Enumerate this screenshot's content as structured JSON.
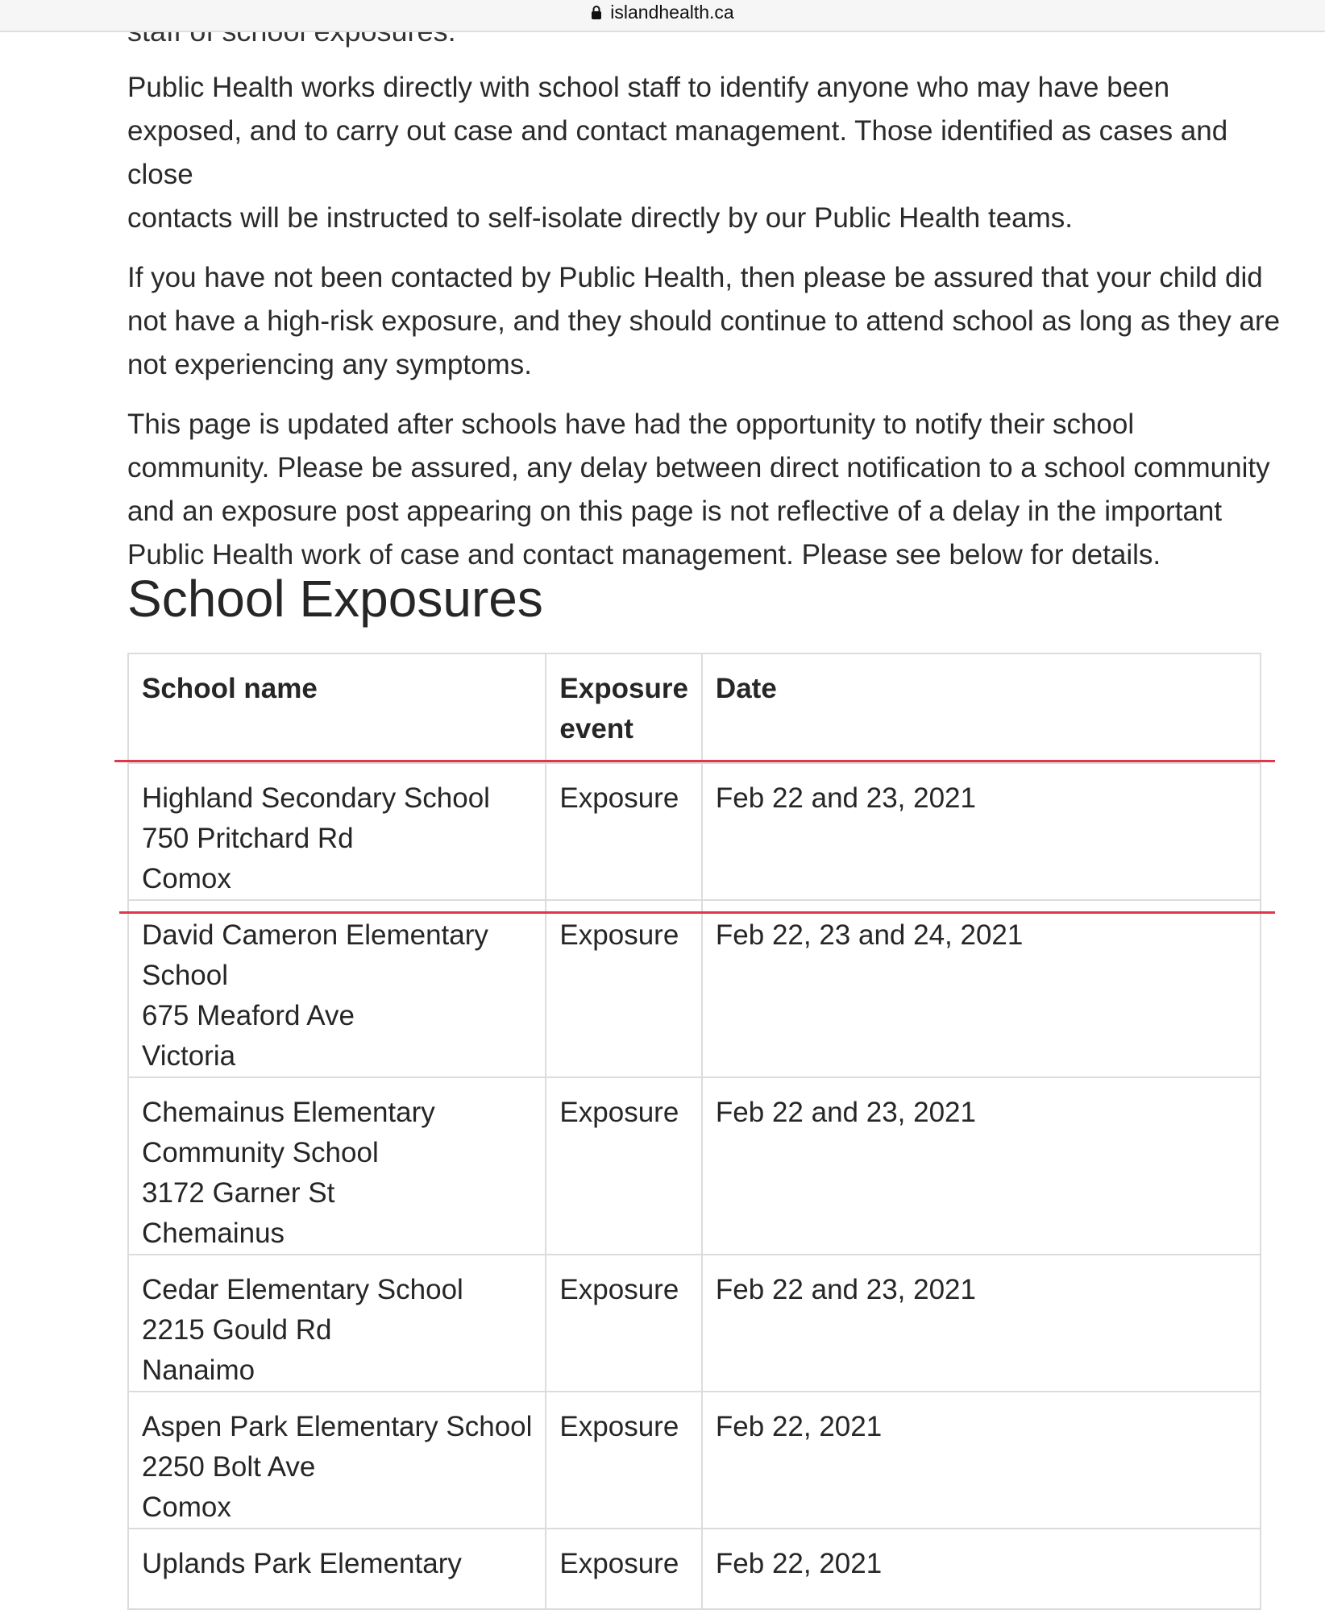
{
  "browser": {
    "url": "islandhealth.ca"
  },
  "fragment": "staff of school exposures.",
  "paragraphs": [
    "Public Health works directly with school staff to identify anyone who may have been\nexposed, and to carry out case and contact management. Those identified as cases and close\ncontacts will be instructed to self-isolate directly by our Public Health teams.",
    "If you have not been contacted by Public Health, then please be assured that your child did\nnot have a high-risk exposure, and they should continue to attend school as long as they are\nnot experiencing any symptoms.",
    "This page is updated after schools have had the opportunity to notify their school\ncommunity. Please be assured, any delay between direct notification to a school community\nand an exposure post appearing on this page is not reflective of a delay in the important\nPublic Health work of case and contact management. Please see below for details."
  ],
  "section_title": "School Exposures",
  "table": {
    "headers": {
      "school_name": "School name",
      "exposure_event": "Exposure event",
      "date": "Date"
    },
    "rows": [
      {
        "school": [
          "Highland Secondary School",
          "750 Pritchard Rd",
          "Comox"
        ],
        "event": "Exposure",
        "date": "Feb 22 and 23, 2021"
      },
      {
        "school": [
          "David Cameron Elementary",
          "School",
          "675 Meaford Ave",
          "Victoria"
        ],
        "event": "Exposure",
        "date": "Feb 22, 23 and 24, 2021"
      },
      {
        "school": [
          "Chemainus Elementary",
          "Community School",
          "3172 Garner St",
          "Chemainus"
        ],
        "event": "Exposure",
        "date": "Feb 22 and 23, 2021"
      },
      {
        "school": [
          "Cedar Elementary School",
          "2215 Gould Rd",
          "Nanaimo"
        ],
        "event": "Exposure",
        "date": "Feb 22 and 23, 2021"
      },
      {
        "school": [
          "Aspen Park Elementary School",
          "2250 Bolt Ave",
          "Comox"
        ],
        "event": "Exposure",
        "date": "Feb 22, 2021"
      },
      {
        "school": [
          "Uplands Park Elementary"
        ],
        "event": "Exposure",
        "date": "Feb 22, 2021"
      }
    ]
  },
  "colors": {
    "highlight": "#e0374a",
    "table_border": "#dcdcdc",
    "text": "#262626"
  }
}
